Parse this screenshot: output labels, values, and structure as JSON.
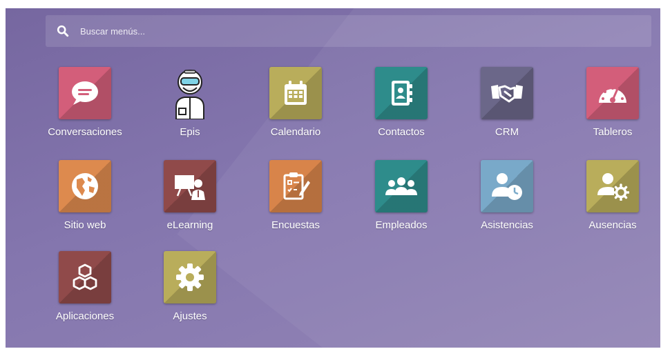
{
  "search": {
    "placeholder": "Buscar menús..."
  },
  "apps": [
    {
      "label": "Conversaciones",
      "icon": "chat-bubble-icon",
      "color": "#d35e7a"
    },
    {
      "label": "Epis",
      "icon": "protective-suit-worker-icon",
      "color": "transparent"
    },
    {
      "label": "Calendario",
      "icon": "calendar-icon",
      "color": "#b9ad5b"
    },
    {
      "label": "Contactos",
      "icon": "address-book-icon",
      "color": "#2e8c8b"
    },
    {
      "label": "CRM",
      "icon": "handshake-icon",
      "color": "#6b6789"
    },
    {
      "label": "Tableros",
      "icon": "dashboard-gauge-icon",
      "color": "#d35e7a"
    },
    {
      "label": "Sitio web",
      "icon": "globe-icon",
      "color": "#dd8a4e"
    },
    {
      "label": "eLearning",
      "icon": "teacher-board-icon",
      "color": "#904a4a"
    },
    {
      "label": "Encuestas",
      "icon": "survey-clipboard-icon",
      "color": "#d8844a"
    },
    {
      "label": "Empleados",
      "icon": "team-users-icon",
      "color": "#2e8c8b"
    },
    {
      "label": "Asistencias",
      "icon": "user-clock-icon",
      "color": "#79a9c9"
    },
    {
      "label": "Ausencias",
      "icon": "user-gear-icon",
      "color": "#b9ad5b"
    },
    {
      "label": "Aplicaciones",
      "icon": "cubes-icon",
      "color": "#904a4a"
    },
    {
      "label": "Ajustes",
      "icon": "gear-icon",
      "color": "#b9ad5b"
    }
  ]
}
